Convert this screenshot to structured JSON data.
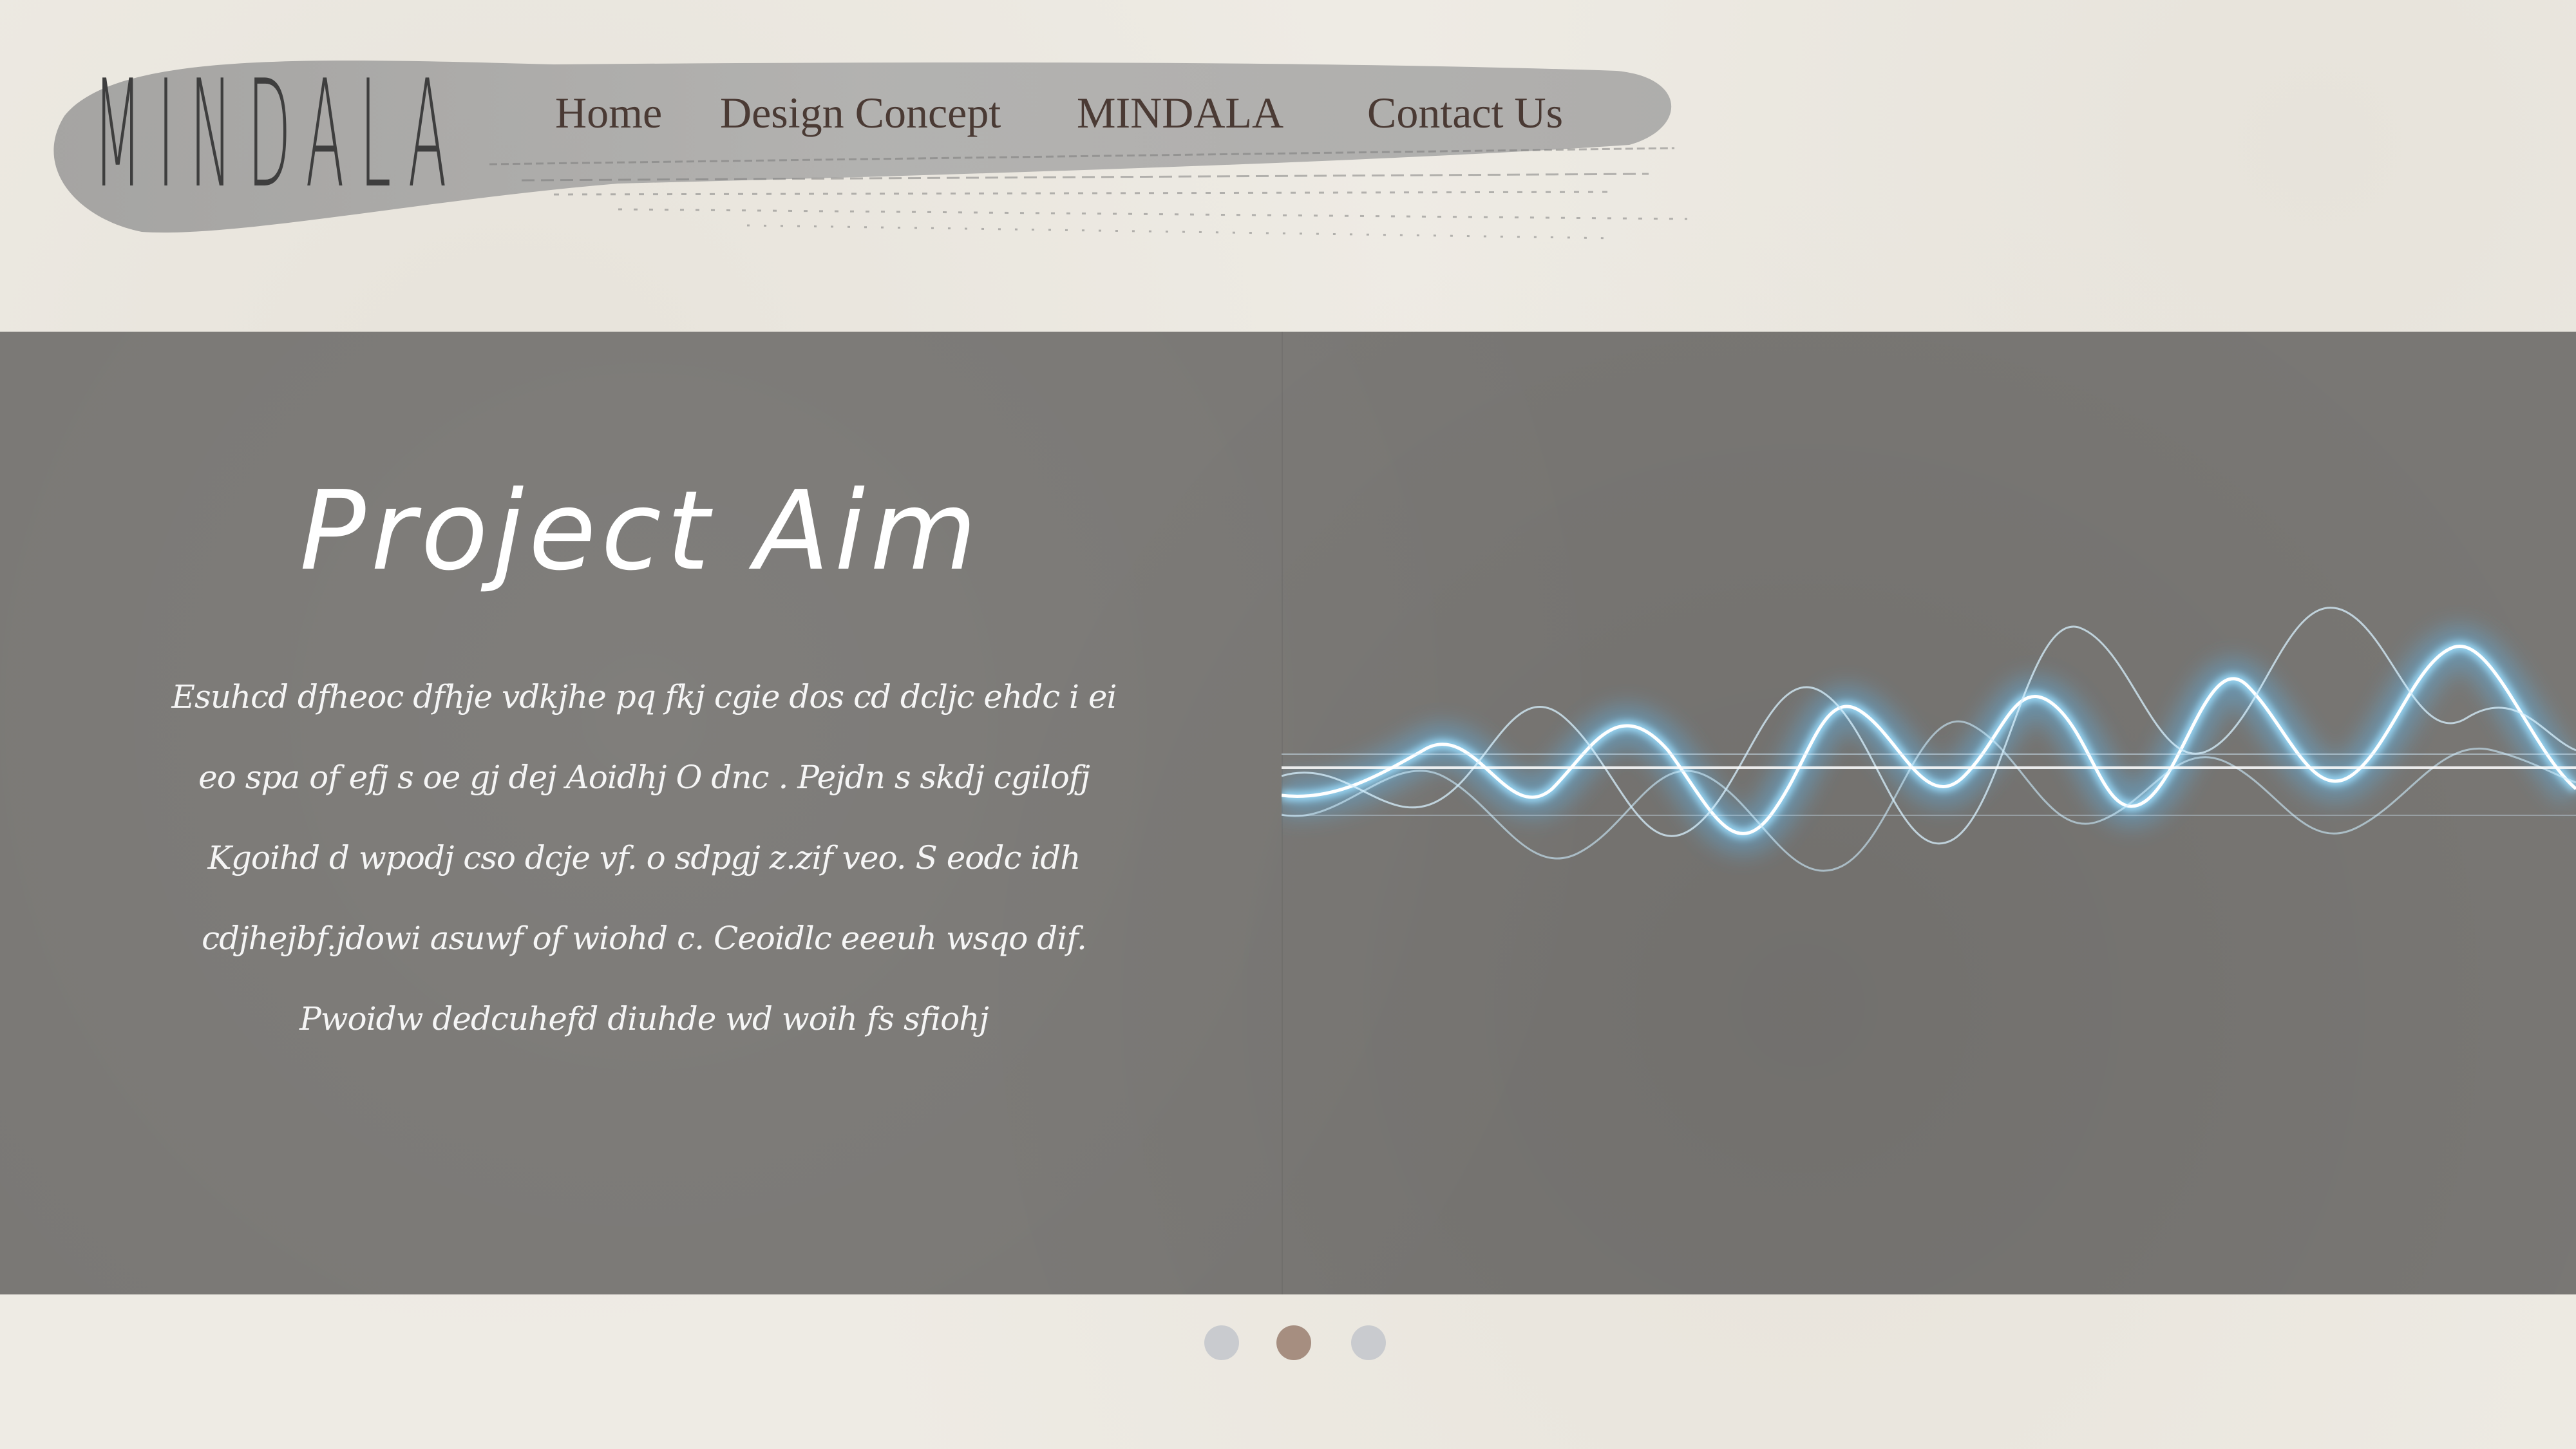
{
  "brand": {
    "logo_text": "MINDALA"
  },
  "nav": {
    "items": [
      {
        "label": "Home"
      },
      {
        "label": "Design Concept"
      },
      {
        "label": "MINDALA"
      },
      {
        "label": "Contact Us"
      }
    ]
  },
  "hero": {
    "title": "Project Aim",
    "body": "Esuhcd dfheoc dfhje vdkjhe pq fkj cgie dos cd  dcljc ehdc i  ei eo spa of  efj s oe gj  dej  Aoidhj O dnc . Pejdn s skdj cgilofj Kgoihd d wpodj cso dcje vf. o sdpgj z.zif veo. S eodc idh cdjhejbf.jdowi asuwf of wiohd c. Ceoidlc eeeuh wsqo dif. Pwoidw dedcuhefd diuhde wd woih fs sfiohj"
  },
  "carousel": {
    "active_index": 1,
    "count": 3
  },
  "colors": {
    "panel": "#797774",
    "dot_inactive": "#c9cbcf",
    "dot_active": "#a68e80",
    "nav_text": "#4a3a34",
    "wave_glow": "#5cc2ff"
  }
}
